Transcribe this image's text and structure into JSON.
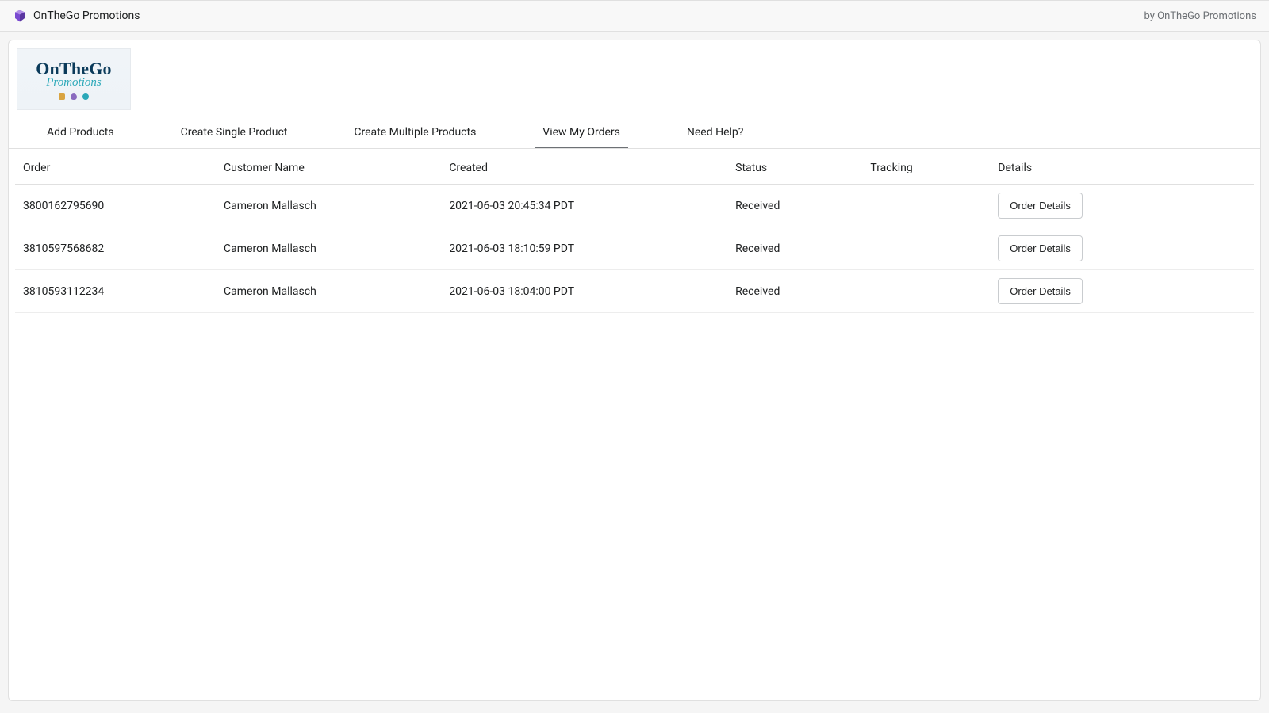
{
  "header": {
    "app_title": "OnTheGo Promotions",
    "byline": "by OnTheGo Promotions"
  },
  "logo": {
    "line1": "OnTheGo",
    "line2": "Promotions"
  },
  "tabs": [
    {
      "label": "Add Products",
      "active": false
    },
    {
      "label": "Create Single Product",
      "active": false
    },
    {
      "label": "Create Multiple Products",
      "active": false
    },
    {
      "label": "View My Orders",
      "active": true
    },
    {
      "label": "Need Help?",
      "active": false
    }
  ],
  "table": {
    "columns": [
      "Order",
      "Customer Name",
      "Created",
      "Status",
      "Tracking",
      "Details"
    ],
    "rows": [
      {
        "order": "3800162795690",
        "customer": "Cameron Mallasch",
        "created": "2021-06-03 20:45:34 PDT",
        "status": "Received",
        "tracking": "",
        "details_label": "Order Details"
      },
      {
        "order": "3810597568682",
        "customer": "Cameron Mallasch",
        "created": "2021-06-03 18:10:59 PDT",
        "status": "Received",
        "tracking": "",
        "details_label": "Order Details"
      },
      {
        "order": "3810593112234",
        "customer": "Cameron Mallasch",
        "created": "2021-06-03 18:04:00 PDT",
        "status": "Received",
        "tracking": "",
        "details_label": "Order Details"
      }
    ]
  }
}
